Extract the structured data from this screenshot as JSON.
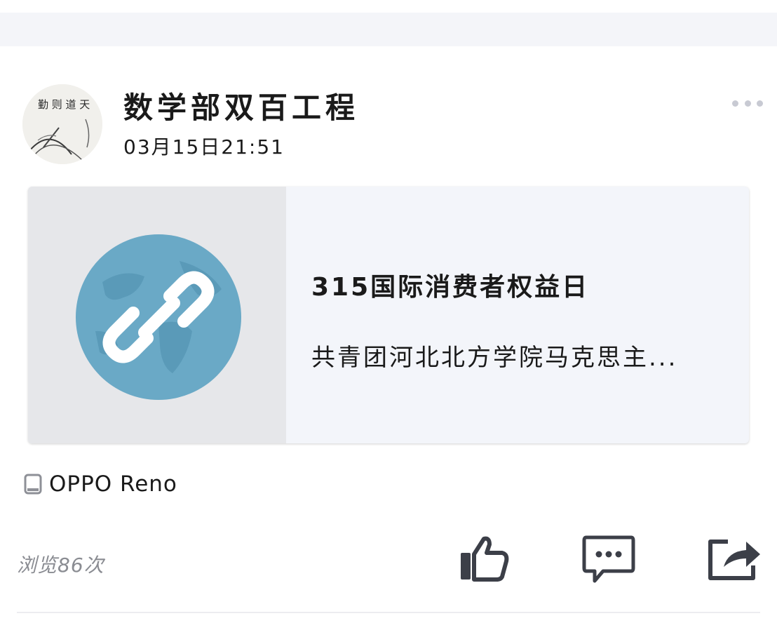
{
  "post": {
    "author_name": "数学部双百工程",
    "timestamp": "03月15日21:51",
    "avatar_icon": "ink-painting-avatar",
    "more_icon": "more-dots-icon"
  },
  "link_card": {
    "title": "315国际消费者权益日",
    "description": "共青团河北北方学院马克思主...",
    "thumbnail_icon": "link-globe-icon",
    "accent_color": "#6aa9c6"
  },
  "device": {
    "icon": "phone-icon",
    "label": "OPPO Reno"
  },
  "footer": {
    "views_label": "浏览86次",
    "like_icon": "thumbs-up-icon",
    "comment_icon": "comment-icon",
    "share_icon": "share-icon"
  }
}
